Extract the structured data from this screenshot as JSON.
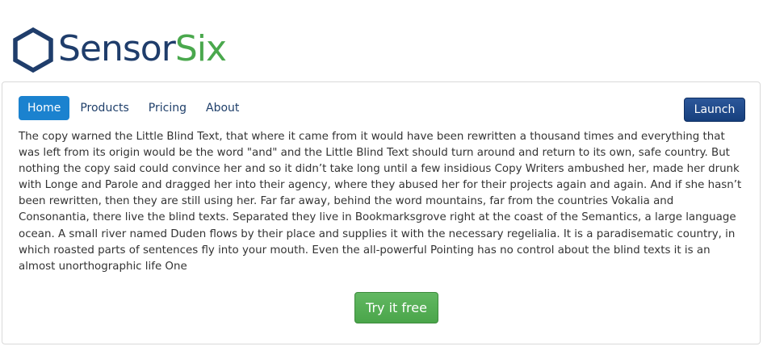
{
  "brand": {
    "word1": "Sensor",
    "word2": "Six",
    "colors": {
      "primary": "#1f3d6b",
      "accent": "#4aa84d"
    },
    "icon": "hexagon-logo-icon"
  },
  "nav": {
    "items": [
      {
        "label": "Home",
        "active": true
      },
      {
        "label": "Products",
        "active": false
      },
      {
        "label": "Pricing",
        "active": false
      },
      {
        "label": "About",
        "active": false
      }
    ],
    "active_color": "#1b82cf"
  },
  "launch_label": "Launch",
  "body": "The copy warned the Little Blind Text, that where it came from it would have been rewritten a thousand times and everything that was left from its origin would be the word \"and\" and the Little Blind Text should turn around and return to its own, safe country. But nothing the copy said could convince her and so it didn’t take long until a few insidious Copy Writers ambushed her, made her drunk with Longe and Parole and dragged her into their agency, where they abused her for their projects again and again. And if she hasn’t been rewritten, then they are still using her. Far far away, behind the word mountains, far from the countries Vokalia and Consonantia, there live the blind texts. Separated they live in Bookmarksgrove right at the coast of the Semantics, a large language ocean. A small river named Duden flows by their place and supplies it with the necessary regelialia. It is a paradisematic country, in which roasted parts of sentences fly into your mouth. Even the all-powerful Pointing has no control about the blind texts it is an almost unorthographic life One",
  "cta_label": "Try it free"
}
